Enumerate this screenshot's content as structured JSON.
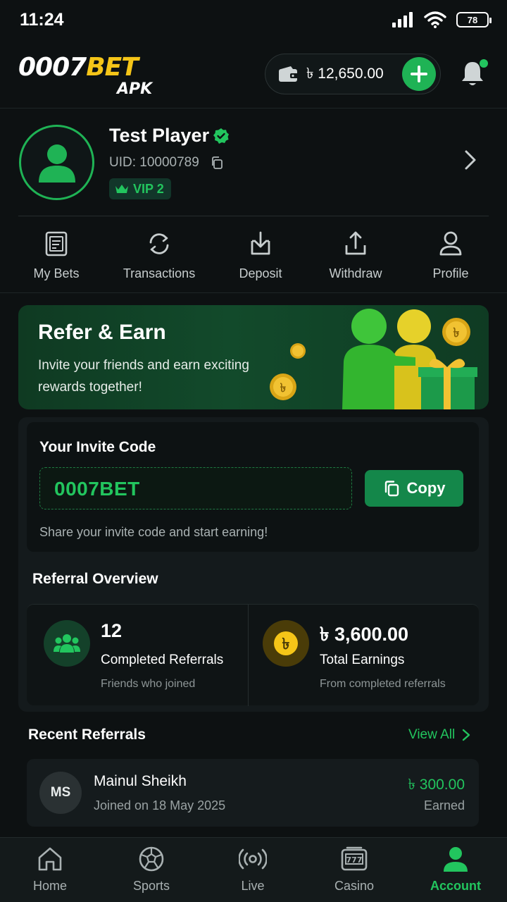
{
  "status": {
    "time": "11:24",
    "battery": "78"
  },
  "header": {
    "logo_main_white": "0007",
    "logo_main_yellow": "BET",
    "logo_sub": "APK",
    "currency": "৳",
    "balance": "৳ 12,650.00"
  },
  "profile": {
    "name": "Test Player",
    "uid": "UID: 10000789",
    "vip": "VIP 2"
  },
  "actions": [
    {
      "label": "My Bets",
      "icon": "receipt-icon"
    },
    {
      "label": "Transactions",
      "icon": "refresh-icon"
    },
    {
      "label": "Deposit",
      "icon": "download-tray-icon"
    },
    {
      "label": "Withdraw",
      "icon": "upload-tray-icon"
    },
    {
      "label": "Profile",
      "icon": "person-icon"
    }
  ],
  "banner": {
    "title": "Refer & Earn",
    "text": "Invite your friends and earn exciting rewards together!"
  },
  "invite": {
    "title": "Your Invite Code",
    "code": "0007BET",
    "copy_label": "Copy",
    "hint": "Share your invite code and start earning!"
  },
  "overview": {
    "title": "Referral Overview",
    "completed": {
      "value": "12",
      "label": "Completed Referrals",
      "sub": "Friends who joined"
    },
    "earnings": {
      "value": "৳ 3,600.00",
      "label": "Total Earnings",
      "sub": "From completed referrals"
    }
  },
  "recent": {
    "title": "Recent Referrals",
    "view_all": "View All",
    "items": [
      {
        "initials": "MS",
        "name": "Mainul Sheikh",
        "date": "Joined on 18 May 2025",
        "amount": "৳ 300.00",
        "status": "Earned"
      }
    ]
  },
  "nav": [
    {
      "label": "Home",
      "icon": "home-icon"
    },
    {
      "label": "Sports",
      "icon": "soccer-ball-icon"
    },
    {
      "label": "Live",
      "icon": "broadcast-icon"
    },
    {
      "label": "Casino",
      "icon": "slot-machine-icon"
    },
    {
      "label": "Account",
      "icon": "account-icon",
      "active": true
    }
  ],
  "colors": {
    "accent": "#22c55e",
    "gold": "#f5c518",
    "background": "#0d1112"
  }
}
